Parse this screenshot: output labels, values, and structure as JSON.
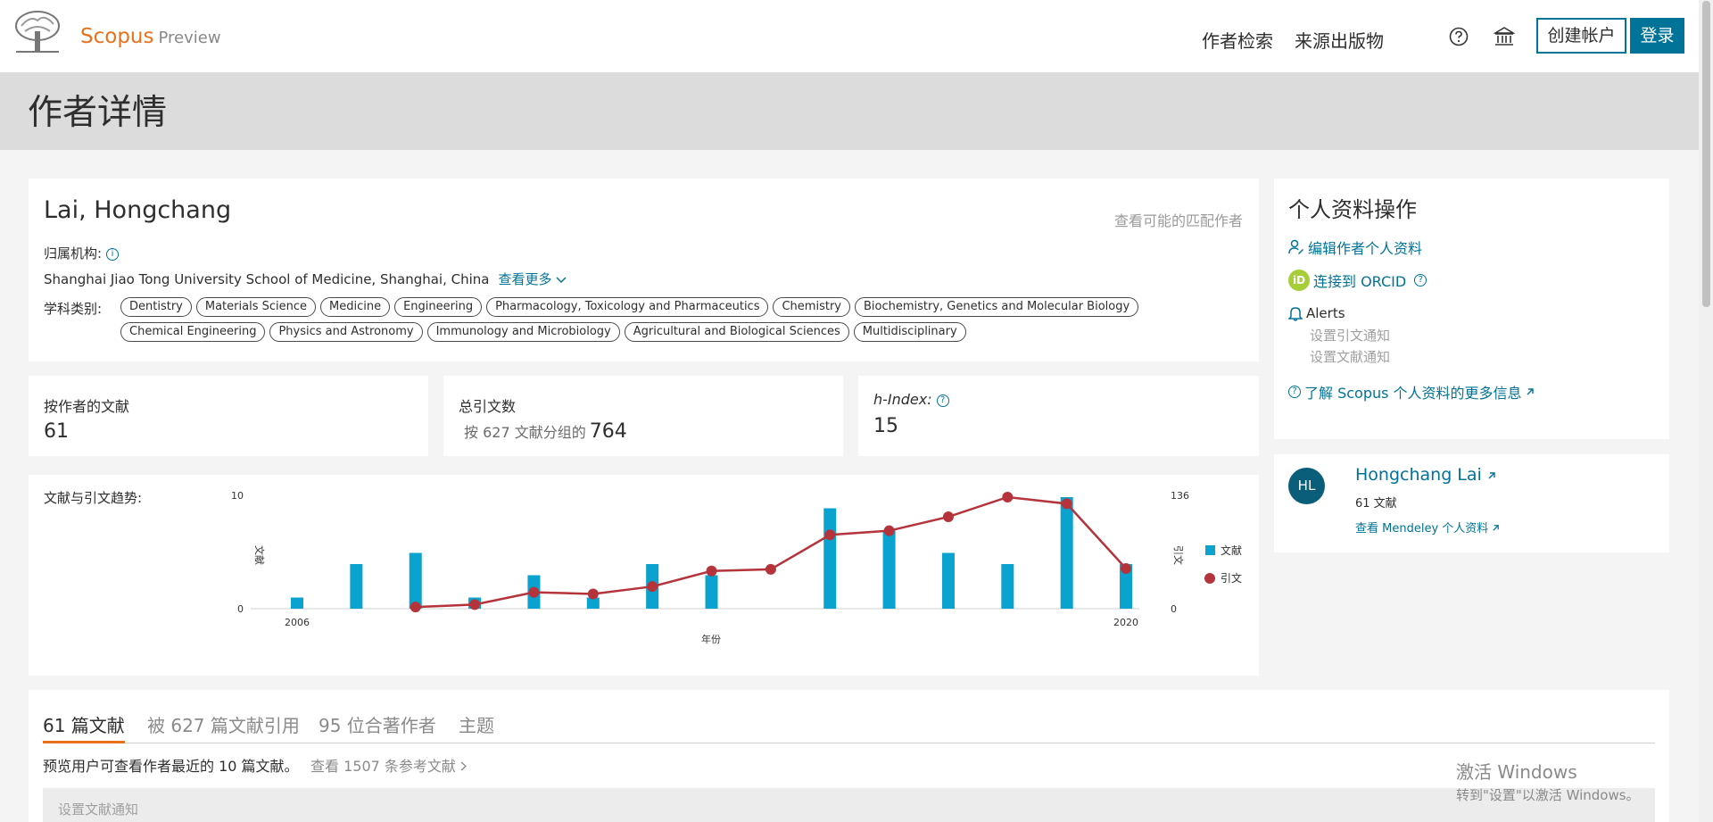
{
  "header": {
    "brand": "Scopus",
    "brand_suffix": "Preview",
    "nav_author_search": "作者检索",
    "nav_sources": "来源出版物",
    "create_account": "创建帐户",
    "login": "登录"
  },
  "page_title": "作者详情",
  "author": {
    "name": "Lai, Hongchang",
    "possible_match": "查看可能的匹配作者",
    "affiliation_label": "归属机构:",
    "affiliation": "Shanghai Jiao Tong University School of Medicine, Shanghai, China",
    "see_more": "查看更多",
    "subjects_label": "学科类别:",
    "subjects": [
      "Dentistry",
      "Materials Science",
      "Medicine",
      "Engineering",
      "Pharmacology, Toxicology and Pharmaceutics",
      "Chemistry",
      "Biochemistry, Genetics and Molecular Biology",
      "Chemical Engineering",
      "Physics and Astronomy",
      "Immunology and Microbiology",
      "Agricultural and Biological Sciences",
      "Multidisciplinary"
    ]
  },
  "metrics": {
    "docs_label": "按作者的文献",
    "docs_value": "61",
    "cites_label": "总引文数",
    "cites_sub": "按 627 文献分组的",
    "cites_value": "764",
    "hindex_label": "h-Index:",
    "hindex_value": "15"
  },
  "chart_data": {
    "type": "bar",
    "title": "文献与引文趋势:",
    "xlabel": "年份",
    "ylabel_left": "文献",
    "ylabel_right": "引文",
    "x_tick_labels": [
      "2006",
      "2020"
    ],
    "y_left_ticks": [
      "0",
      "10"
    ],
    "y_right_ticks": [
      "0",
      "136"
    ],
    "ylim_left": [
      0,
      10
    ],
    "ylim_right": [
      0,
      136
    ],
    "categories": [
      2006,
      2007,
      2008,
      2009,
      2010,
      2011,
      2012,
      2013,
      2014,
      2015,
      2016,
      2017,
      2018,
      2019,
      2020
    ],
    "series": [
      {
        "name": "文献",
        "kind": "bar",
        "color": "#0aa3cf",
        "values": [
          1,
          4,
          5,
          1,
          3,
          1,
          4,
          3,
          null,
          9,
          7,
          5,
          4,
          10,
          4
        ]
      },
      {
        "name": "引文",
        "kind": "line",
        "color": "#b5343b",
        "values": [
          null,
          null,
          2,
          5,
          20,
          18,
          27,
          46,
          48,
          90,
          95,
          112,
          136,
          128,
          49
        ]
      }
    ],
    "legend_position": "right"
  },
  "profile_actions": {
    "title": "个人资料操作",
    "edit_profile": "编辑作者个人资料",
    "connect_orcid": "连接到 ORCID",
    "alerts": "Alerts",
    "citation_alert": "设置引文通知",
    "document_alert": "设置文献通知",
    "learn_more": "了解 Scopus 个人资料的更多信息"
  },
  "mendeley": {
    "initials": "HL",
    "name": "Hongchang Lai",
    "docs": "61 文献",
    "view_profile": "查看 Mendeley 个人资料"
  },
  "tabs": {
    "documents": "61 篇文献",
    "cited_by": "被 627 篇文献引用",
    "coauthors": "95 位合著作者",
    "topics": "主题"
  },
  "documents": {
    "preview_note": "预览用户可查看作者最近的 10 篇文献。",
    "view_refs": "查看 1507 条参考文献",
    "set_alert": "设置文献通知"
  },
  "watermark": {
    "title": "激活 Windows",
    "sub": "转到\"设置\"以激活 Windows。"
  }
}
